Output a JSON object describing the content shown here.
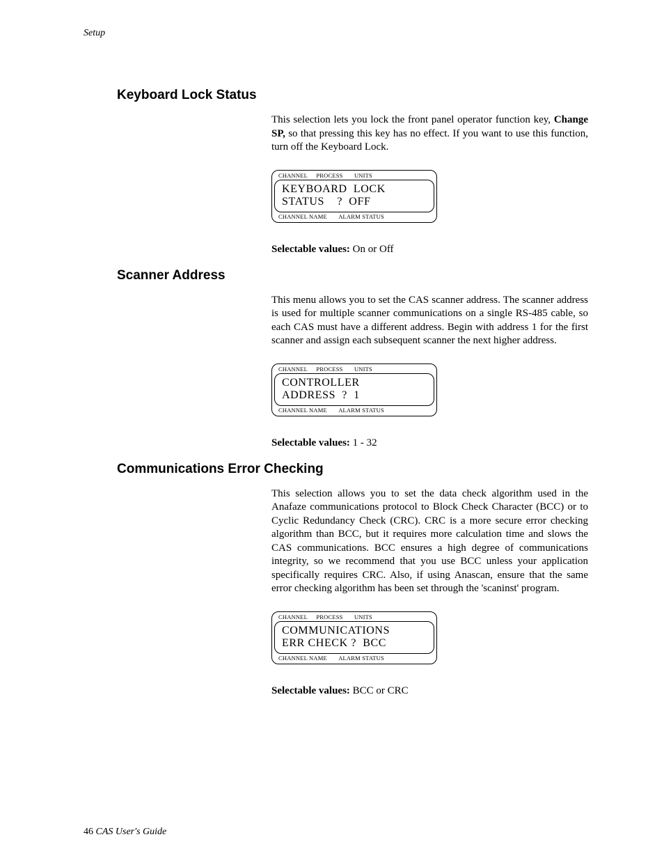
{
  "header_section": "Setup",
  "footer": {
    "page": "46",
    "title": "CAS User's Guide"
  },
  "lcd_labels": {
    "channel": "CHANNEL",
    "process": "PROCESS",
    "units": "UNITS",
    "channel_name": "CHANNEL NAME",
    "alarm_status": "ALARM STATUS"
  },
  "sections": {
    "keyboard_lock": {
      "title": "Keyboard Lock Status",
      "para_before": "This selection lets you lock the front panel operator function key, ",
      "para_bold": "Change SP,",
      "para_after": " so that pressing this key has no effect. If you want to use this function, turn off the Keyboard Lock.",
      "lcd_line1": "KEYBOARD  LOCK",
      "lcd_line2": "STATUS    ?  OFF",
      "selectable_label": "Selectable values:",
      "selectable_value": " On or Off"
    },
    "scanner_address": {
      "title": "Scanner Address",
      "para": "This menu allows you to set the CAS scanner address. The scanner address is used for multiple scanner communications on a single RS-485 cable, so each CAS must have a different address. Begin with address 1 for the first scanner and assign each subsequent scanner the next higher address.",
      "lcd_line1": "CONTROLLER",
      "lcd_line2": "ADDRESS  ?  1",
      "selectable_label": "Selectable values:",
      "selectable_value": " 1 - 32"
    },
    "comm_err": {
      "title": "Communications Error Checking",
      "para": "This selection allows you to set the data check algorithm used in the Anafaze communications protocol to Block Check Character (BCC) or to Cyclic Redundancy Check (CRC). CRC is a more secure error checking algorithm than BCC, but it requires more calculation time and slows the CAS communications. BCC ensures a high degree of communications integrity, so we recommend that you use BCC unless your application specifically requires CRC. Also, if using Anascan, ensure that the same error checking algorithm has been set through the 'scaninst' program.",
      "lcd_line1": "COMMUNICATIONS",
      "lcd_line2": "ERR CHECK ?  BCC",
      "selectable_label": "Selectable values:",
      "selectable_value": " BCC or CRC"
    }
  }
}
